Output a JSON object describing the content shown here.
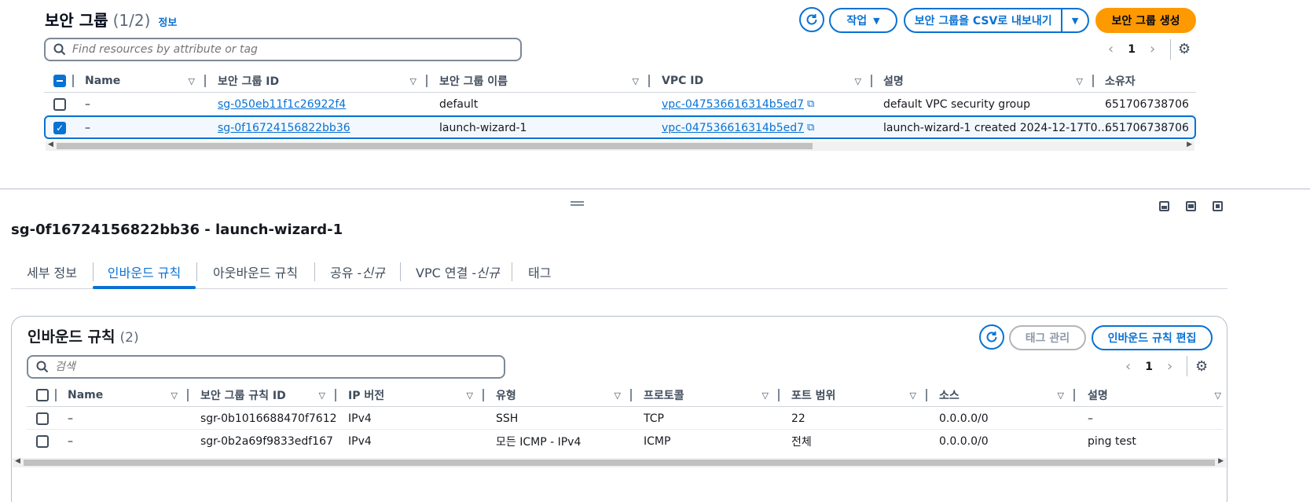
{
  "top": {
    "title": "보안 그룹",
    "count": "(1/2)",
    "info": "정보",
    "actions_label": "작업",
    "export_label": "보안 그룹을 CSV로 내보내기",
    "create_label": "보안 그룹 생성",
    "search_placeholder": "Find resources by attribute or tag",
    "page": "1",
    "columns": [
      "Name",
      "보안 그룹 ID",
      "보안 그룹 이름",
      "VPC ID",
      "설명",
      "소유자"
    ],
    "rows": [
      {
        "name": "–",
        "id": "sg-050eb11f1c26922f4",
        "group_name": "default",
        "vpc": "vpc-047536616314b5ed7",
        "desc": "default VPC security group",
        "owner": "651706738706",
        "selected": false
      },
      {
        "name": "–",
        "id": "sg-0f16724156822bb36",
        "group_name": "launch-wizard-1",
        "vpc": "vpc-047536616314b5ed7",
        "desc": "launch-wizard-1 created 2024-12-17T0…",
        "owner": "651706738706",
        "selected": true
      }
    ]
  },
  "detail": {
    "title": "sg-0f16724156822bb36 - launch-wizard-1",
    "tabs": [
      {
        "label": "세부 정보",
        "suffix": ""
      },
      {
        "label": "인바운드 규칙",
        "suffix": ""
      },
      {
        "label": "아웃바운드 규칙",
        "suffix": ""
      },
      {
        "label": "공유 - ",
        "suffix": "신규"
      },
      {
        "label": "VPC 연결 - ",
        "suffix": "신규"
      },
      {
        "label": "태그",
        "suffix": ""
      }
    ],
    "active_tab": 1
  },
  "inbound": {
    "title": "인바운드 규칙",
    "count": "(2)",
    "manage_tags": "태그 관리",
    "edit_rules": "인바운드 규칙 편집",
    "search_placeholder": "검색",
    "page": "1",
    "columns": [
      "Name",
      "보안 그룹 규칙 ID",
      "IP 버전",
      "유형",
      "프로토콜",
      "포트 범위",
      "소스",
      "설명"
    ],
    "rows": [
      {
        "name": "–",
        "rule_id": "sgr-0b1016688470f7612",
        "ip": "IPv4",
        "type": "SSH",
        "protocol": "TCP",
        "port": "22",
        "source": "0.0.0.0/0",
        "desc": "–"
      },
      {
        "name": "–",
        "rule_id": "sgr-0b2a69f9833edf167",
        "ip": "IPv4",
        "type": "모든 ICMP - IPv4",
        "protocol": "ICMP",
        "port": "전체",
        "source": "0.0.0.0/0",
        "desc": "ping test"
      }
    ]
  },
  "icons": {
    "refresh": "refresh-icon",
    "search": "search-icon",
    "settings": "gear-icon",
    "external": "external-link-icon",
    "caret": "caret-down-icon"
  },
  "colors": {
    "accent": "#0972d3",
    "primary_button": "#ff9900"
  }
}
